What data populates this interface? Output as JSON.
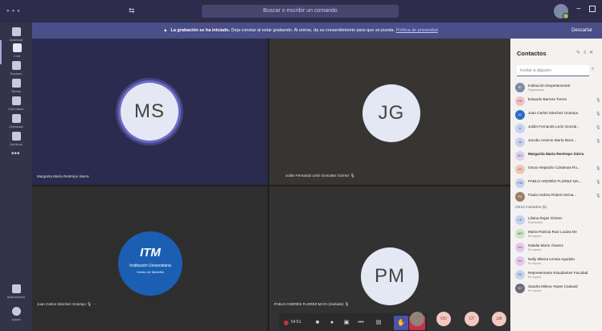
{
  "titlebar": {
    "nav_label": "⇆",
    "search_placeholder": "Buscar o escribir un comando",
    "window_controls": [
      "minimize",
      "maximize"
    ]
  },
  "rail": {
    "items": [
      {
        "label": "Actividad",
        "icon": "bell-icon"
      },
      {
        "label": "Chat",
        "icon": "chat-icon"
      },
      {
        "label": "Equipos",
        "icon": "teams-icon"
      },
      {
        "label": "Tareas",
        "icon": "tasks-icon"
      },
      {
        "label": "Calendario",
        "icon": "calendar-icon"
      },
      {
        "label": "Llamadas",
        "icon": "phone-icon"
      },
      {
        "label": "Archivos",
        "icon": "files-icon"
      }
    ],
    "more_label": "•••",
    "bottom_items": [
      {
        "label": "Aplicaciones",
        "icon": "apps-icon"
      },
      {
        "label": "Ayuda",
        "icon": "help-icon"
      }
    ]
  },
  "banner": {
    "icon": "warning-icon",
    "text_bold": "La grabación se ha iniciado.",
    "text": " Deja constar al estar grabando. Al unirse, da su consentimiento para que se pueda.",
    "link": "Política de privacidad",
    "dismiss_label": "Descartar"
  },
  "participants": [
    {
      "initials": "MS",
      "name": "Margarita María Restrepo Sierra",
      "muted": false
    },
    {
      "initials": "JG",
      "name": "Julián Fernando León Gonzalez Gómez",
      "muted": true
    },
    {
      "initials": "",
      "name": "Juan Carlos Sánchez Ocampo",
      "muted": true,
      "logo": {
        "big": "ITM",
        "line1": "Institución Universitaria",
        "line2": "Centro de Medellín"
      }
    },
    {
      "initials": "PM",
      "name": "PABLO ANDRÉS FLOREZ MAYA (Invitado)",
      "muted": true
    }
  ],
  "controls": {
    "timer": "54:51",
    "buttons": [
      "camera-icon",
      "mic-icon",
      "share-icon",
      "more-icon",
      "chat-icon",
      "raise-hand-icon",
      "hang-up-icon"
    ]
  },
  "overflow": [
    "",
    "OO",
    "CT",
    "LM"
  ],
  "panel": {
    "title": "Contactos",
    "search_placeholder": "Invitar a alguien",
    "in_meeting": [
      {
        "name": "Institución Departamental",
        "sub": "Organizador",
        "initials": "ID"
      },
      {
        "name": "Eduardo Barrera Torres",
        "initials": "EB"
      },
      {
        "name": "Juan Carlos Sánchez Ocampo",
        "initials": "JC"
      },
      {
        "name": "Julián Fernando León Gonzal...",
        "initials": "JL"
      },
      {
        "name": "Jacobo Antonio María Mora...",
        "initials": "JA"
      },
      {
        "name": "Margarita María Restrepo Sierra",
        "initials": "MS",
        "bold": true
      },
      {
        "name": "Oscar Alejandro Cárdenas Ru...",
        "initials": "OC"
      },
      {
        "name": "PABLO ANDRÉS FLOREZ MA...",
        "initials": "PM"
      },
      {
        "name": "Paula Andrea Robert Serna...",
        "initials": "PA"
      }
    ],
    "others_label": "Otros invitados (6)",
    "others": [
      {
        "name": "Liliana Rojas Gómez",
        "sub": "Rechazado",
        "initials": "LR"
      },
      {
        "name": "María Patricia Ruiz Loaiza De",
        "sub": "En espera",
        "initials": "MP"
      },
      {
        "name": "Natalia Marín Álvarez",
        "sub": "En espera",
        "initials": "NA"
      },
      {
        "name": "Nelly Milena Urrutia Agudelo",
        "sub": "En espera",
        "initials": "NU"
      },
      {
        "name": "Representante Estudiantes Facultad",
        "sub": "En espera",
        "initials": "RE"
      },
      {
        "name": "Sandra Milena Yepes Cadavid",
        "sub": "En espera",
        "initials": "SY"
      }
    ]
  }
}
